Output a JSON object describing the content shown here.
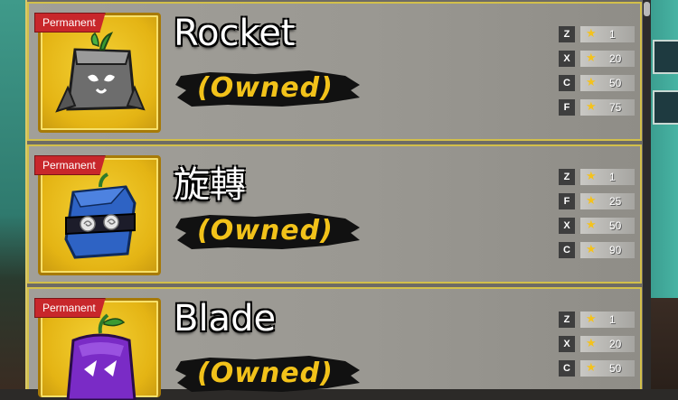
{
  "fruits": [
    {
      "badge": "Permanent",
      "name": "Rocket",
      "status": "(Owned)",
      "moves": [
        {
          "key": "Z",
          "level": "1"
        },
        {
          "key": "X",
          "level": "20"
        },
        {
          "key": "C",
          "level": "50"
        },
        {
          "key": "F",
          "level": "75"
        }
      ]
    },
    {
      "badge": "Permanent",
      "name": "旋轉",
      "status": "(Owned)",
      "moves": [
        {
          "key": "Z",
          "level": "1"
        },
        {
          "key": "F",
          "level": "25"
        },
        {
          "key": "X",
          "level": "50"
        },
        {
          "key": "C",
          "level": "90"
        }
      ]
    },
    {
      "badge": "Permanent",
      "name": "Blade",
      "status": "(Owned)",
      "moves": [
        {
          "key": "Z",
          "level": "1"
        },
        {
          "key": "X",
          "level": "20"
        },
        {
          "key": "C",
          "level": "50"
        }
      ]
    }
  ],
  "colors": {
    "card_border": "#d2bf4a",
    "icon_bg": "#e4b414",
    "owned_text": "#f2c21a",
    "badge_bg": "#c8272b"
  },
  "icons": [
    "rocket-fruit-icon",
    "spin-fruit-icon",
    "blade-fruit-icon",
    "star-icon"
  ]
}
